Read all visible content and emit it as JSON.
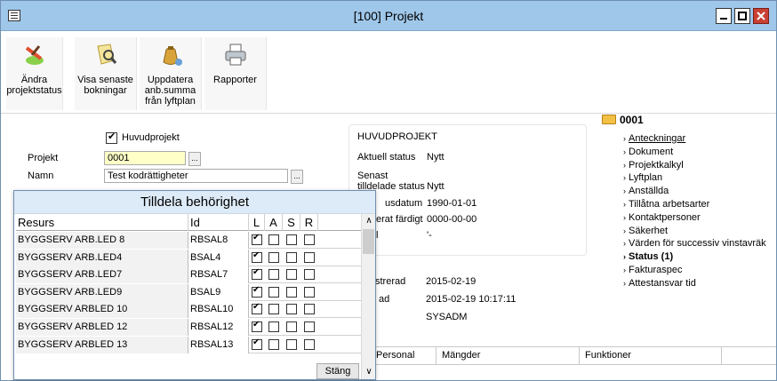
{
  "window": {
    "title": "[100]  Projekt"
  },
  "toolbar": {
    "buttons": [
      {
        "label_lines": [
          "Ändra",
          "projektstatus"
        ],
        "icon": "edit-status-icon"
      },
      {
        "label_lines": [
          "Visa senaste",
          "bokningar"
        ],
        "icon": "view-bookings-icon"
      },
      {
        "label_lines": [
          "Uppdatera",
          "anb.summa",
          "från lyftplan"
        ],
        "icon": "money-bag-icon"
      },
      {
        "label_lines": [
          "Rapporter"
        ],
        "icon": "printer-icon"
      }
    ]
  },
  "form": {
    "main_project_label": "Huvudprojekt",
    "main_project_checked": true,
    "project_label": "Projekt",
    "project_value": "0001",
    "name_label": "Namn",
    "name_value": "Test kodrättigheter"
  },
  "info": {
    "title": "HUVUDPROJEKT",
    "rows": [
      {
        "label": "Aktuell status",
        "value": "Nytt"
      },
      {
        "label": "Senast tilldelade status",
        "value": "Nytt"
      },
      {
        "label": "usdatum",
        "value": "1990-01-01"
      },
      {
        "label": "erat färdigt",
        "value": "0000-00-00"
      },
      {
        "label": "l",
        "value": "'-"
      }
    ]
  },
  "lower": {
    "rows": [
      {
        "label": "strerad",
        "value": "2015-02-19"
      },
      {
        "label": "ad",
        "value": "2015-02-19 10:17:11"
      },
      {
        "label": "",
        "value": "SYSADM"
      }
    ]
  },
  "tree": {
    "root": "0001",
    "items": [
      {
        "label": "Anteckningar",
        "style": "link"
      },
      {
        "label": "Dokument",
        "style": ""
      },
      {
        "label": "Projektkalkyl",
        "style": ""
      },
      {
        "label": "Lyftplan",
        "style": ""
      },
      {
        "label": "Anställda",
        "style": ""
      },
      {
        "label": "Tillåtna arbetsarter",
        "style": ""
      },
      {
        "label": "Kontaktpersoner",
        "style": ""
      },
      {
        "label": "Säkerhet",
        "style": ""
      },
      {
        "label": "Värden för successiv vinstavräk",
        "style": ""
      },
      {
        "label": "Status (1)",
        "style": "active"
      },
      {
        "label": "Fakturaspec",
        "style": ""
      },
      {
        "label": "Attestansvar tid",
        "style": ""
      }
    ]
  },
  "tabs": [
    "Personal",
    "Mängder",
    "Funktioner"
  ],
  "popup": {
    "title": "Tilldela behörighet",
    "columns": [
      "Resurs",
      "Id",
      "L",
      "A",
      "S",
      "R"
    ],
    "rows": [
      {
        "resurs": "BYGGSERV ARB.LED 8",
        "id": "RBSAL8",
        "L": true,
        "A": false,
        "S": false,
        "R": false
      },
      {
        "resurs": "BYGGSERV ARB.LED4",
        "id": "BSAL4",
        "L": true,
        "A": false,
        "S": false,
        "R": false
      },
      {
        "resurs": "BYGGSERV ARB.LED7",
        "id": "RBSAL7",
        "L": true,
        "A": false,
        "S": false,
        "R": false
      },
      {
        "resurs": "BYGGSERV ARB.LED9",
        "id": "BSAL9",
        "L": true,
        "A": false,
        "S": false,
        "R": false
      },
      {
        "resurs": "BYGGSERV ARBLED 10",
        "id": "RBSAL10",
        "L": true,
        "A": false,
        "S": false,
        "R": false
      },
      {
        "resurs": "BYGGSERV ARBLED 12",
        "id": "RBSAL12",
        "L": true,
        "A": false,
        "S": false,
        "R": false
      },
      {
        "resurs": "BYGGSERV ARBLED 13",
        "id": "RBSAL13",
        "L": true,
        "A": false,
        "S": false,
        "R": false
      }
    ],
    "close_label": "Stäng"
  },
  "colors": {
    "titlebar": "#9fc7ea",
    "popup_title": "#ddeaf7",
    "highlight_input": "#ffffc8"
  }
}
